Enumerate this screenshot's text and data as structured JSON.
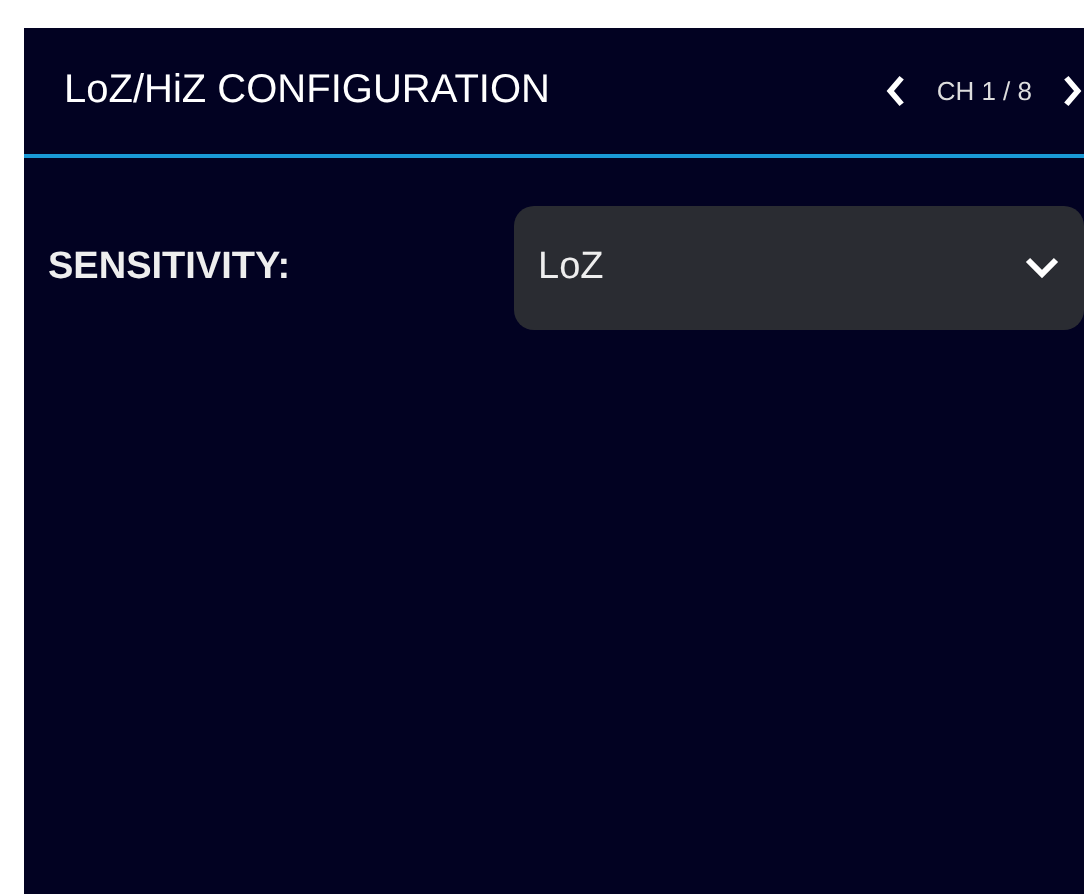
{
  "header": {
    "title": "LoZ/HiZ CONFIGURATION",
    "channel": "CH 1 / 8"
  },
  "settings": [
    {
      "label": "SENSITIVITY:",
      "value": "LoZ"
    }
  ]
}
